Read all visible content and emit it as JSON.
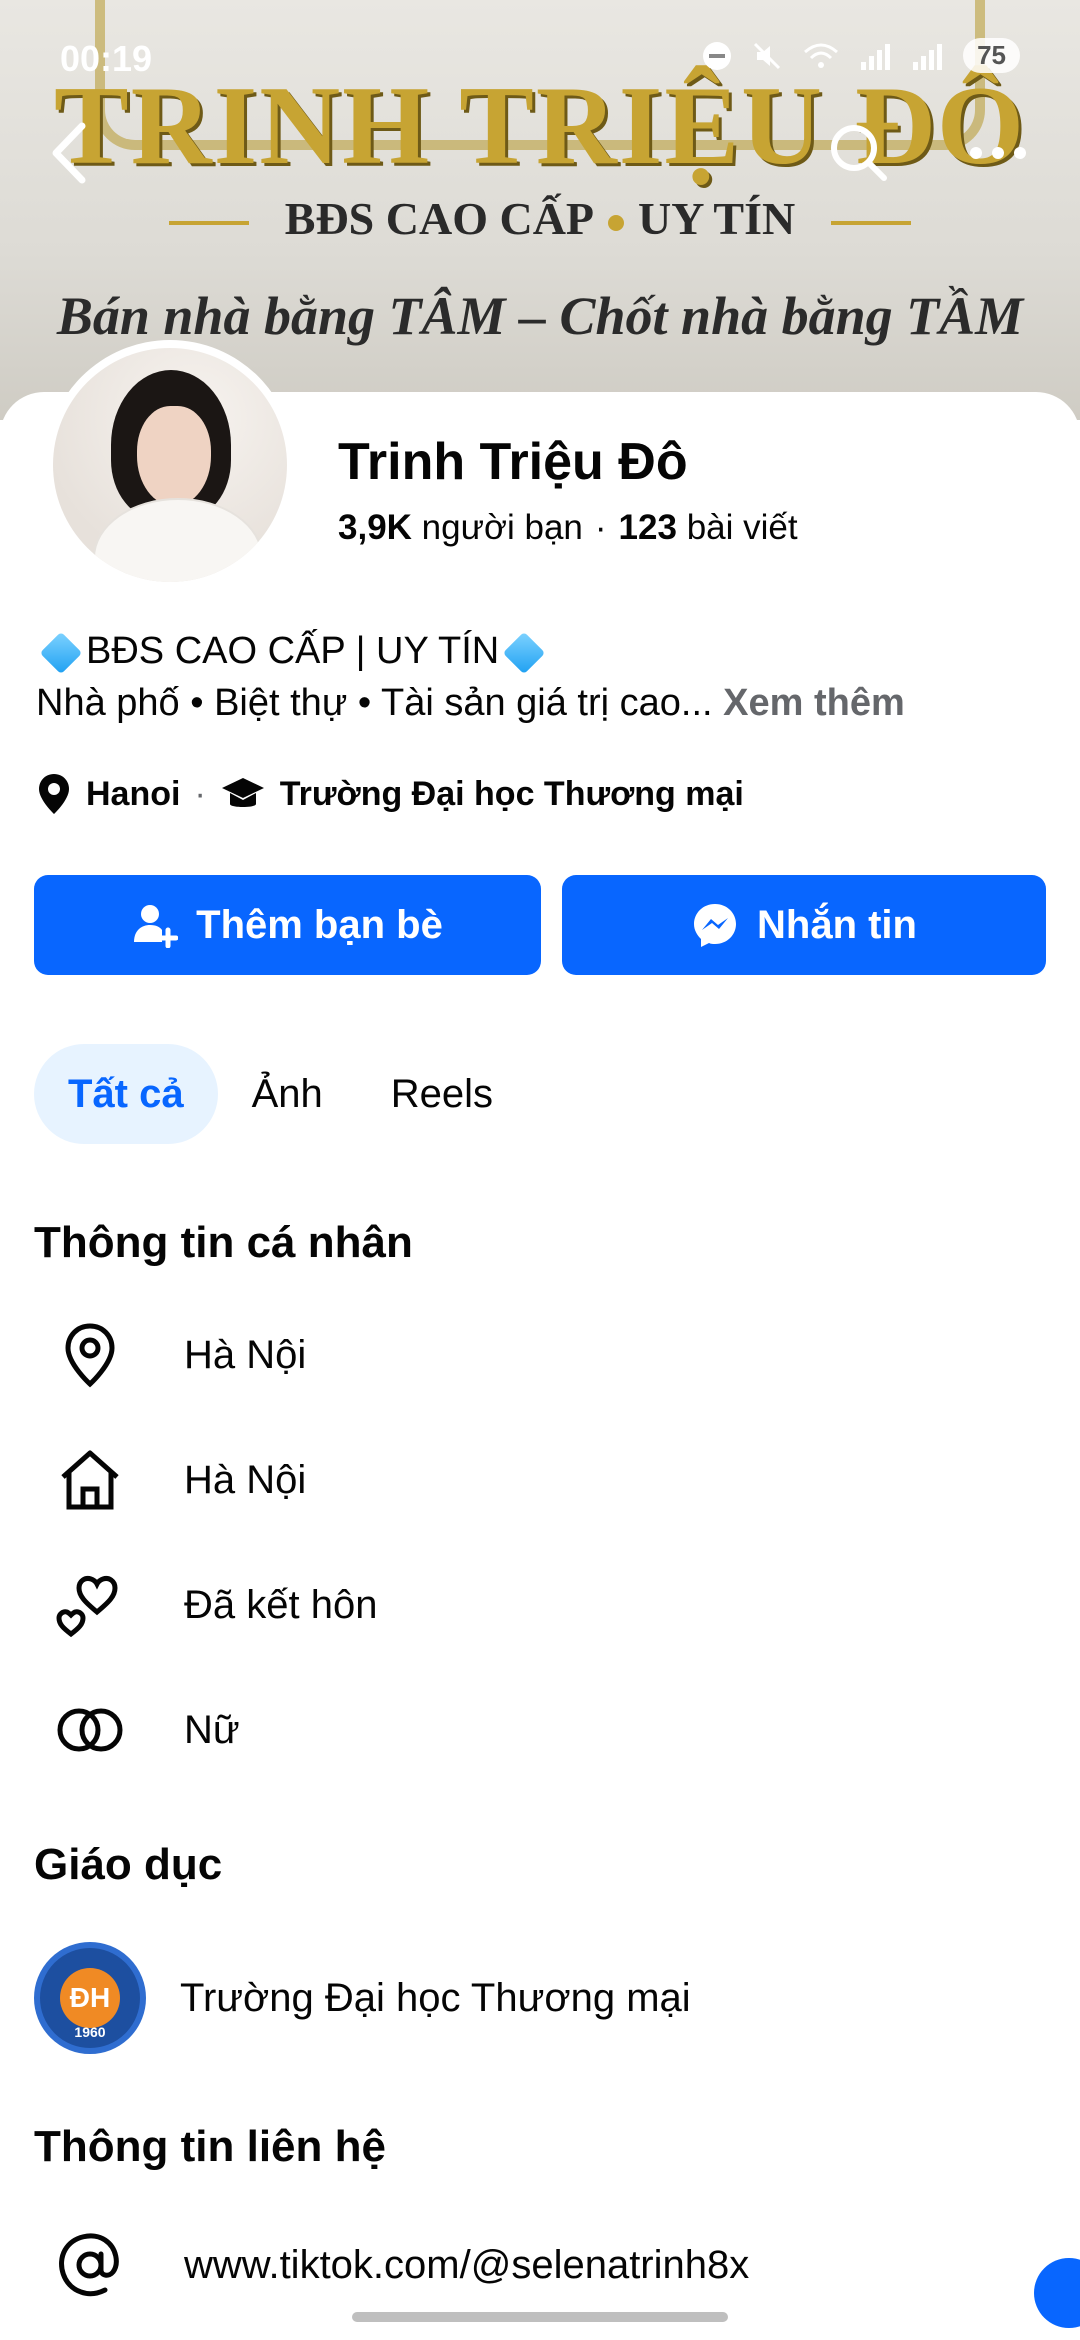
{
  "status_bar": {
    "time": "00:19",
    "battery": "75"
  },
  "cover": {
    "title": "TRINH TRIỆU ĐÔ",
    "subtitle_left": "BĐS CAO CẤP",
    "subtitle_right": "UY TÍN",
    "slogan": "Bán nhà bằng TÂM – Chốt nhà bằng TẦM"
  },
  "profile": {
    "name": "Trinh Triệu Đô",
    "friends_count": "3,9K",
    "friends_label": "người bạn",
    "posts_count": "123",
    "posts_label": "bài viết",
    "bio_line1": "BĐS CAO CẤP | UY TÍN",
    "bio_line2": "Nhà phố • Biệt thự • Tài sản giá trị cao...",
    "see_more": "Xem thêm",
    "location": "Hanoi",
    "school": "Trường Đại học Thương mại"
  },
  "actions": {
    "add_friend": "Thêm bạn bè",
    "message": "Nhắn tin"
  },
  "tabs": [
    {
      "label": "Tất cả"
    },
    {
      "label": "Ảnh"
    },
    {
      "label": "Reels"
    }
  ],
  "personal_info": {
    "title": "Thông tin cá nhân",
    "items": [
      {
        "icon": "location-pin-icon",
        "text": "Hà Nội"
      },
      {
        "icon": "home-icon",
        "text": "Hà Nội"
      },
      {
        "icon": "hearts-icon",
        "text": "Đã kết hôn"
      },
      {
        "icon": "gender-rings-icon",
        "text": "Nữ"
      }
    ]
  },
  "education": {
    "title": "Giáo dục",
    "school": "Trường Đại học Thương mại",
    "logo_year": "1960"
  },
  "contact": {
    "title": "Thông tin liên hệ",
    "website": "www.tiktok.com/@selenatrinh8x"
  },
  "colors": {
    "accent": "#0866ff",
    "accent_light": "#e7f3ff",
    "muted": "#65676b"
  }
}
